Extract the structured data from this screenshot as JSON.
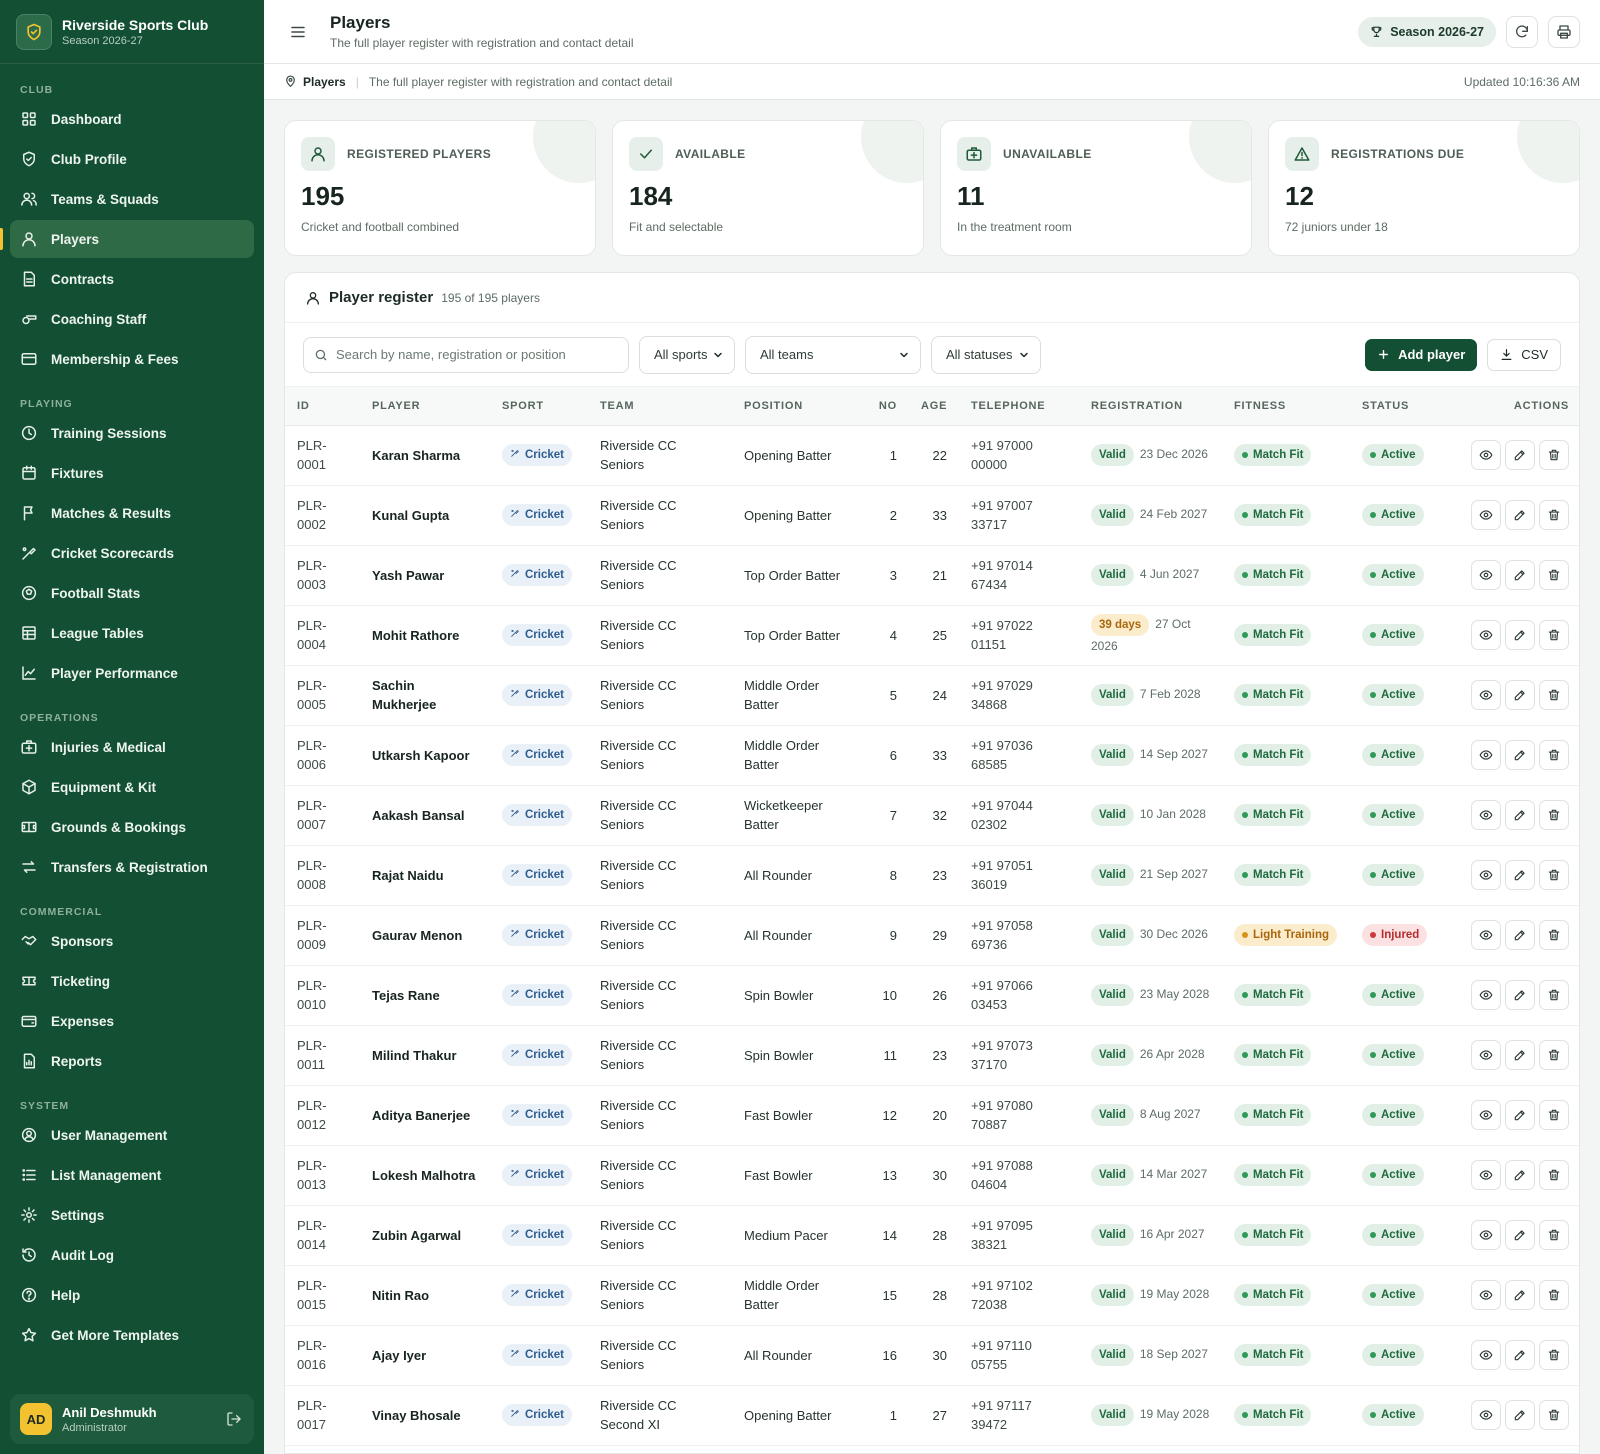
{
  "brand": {
    "name": "Riverside Sports Club",
    "season": "Season 2026-27"
  },
  "nav": [
    {
      "section": "CLUB",
      "items": [
        {
          "id": "dashboard",
          "label": "Dashboard",
          "icon": "grid-icon"
        },
        {
          "id": "club-profile",
          "label": "Club Profile",
          "icon": "shield-icon"
        },
        {
          "id": "teams",
          "label": "Teams & Squads",
          "icon": "users-icon"
        },
        {
          "id": "players",
          "label": "Players",
          "icon": "user-icon",
          "active": true
        },
        {
          "id": "contracts",
          "label": "Contracts",
          "icon": "file-icon"
        },
        {
          "id": "coaching",
          "label": "Coaching Staff",
          "icon": "whistle-icon"
        },
        {
          "id": "membership",
          "label": "Membership & Fees",
          "icon": "card-icon"
        }
      ]
    },
    {
      "section": "PLAYING",
      "items": [
        {
          "id": "training",
          "label": "Training Sessions",
          "icon": "clock-icon"
        },
        {
          "id": "fixtures",
          "label": "Fixtures",
          "icon": "calendar-icon"
        },
        {
          "id": "matches",
          "label": "Matches & Results",
          "icon": "flag-icon"
        },
        {
          "id": "scorecards",
          "label": "Cricket Scorecards",
          "icon": "bat-icon"
        },
        {
          "id": "football",
          "label": "Football Stats",
          "icon": "ball-icon"
        },
        {
          "id": "league",
          "label": "League Tables",
          "icon": "table-icon"
        },
        {
          "id": "performance",
          "label": "Player Performance",
          "icon": "chart-icon"
        }
      ]
    },
    {
      "section": "OPERATIONS",
      "items": [
        {
          "id": "injuries",
          "label": "Injuries & Medical",
          "icon": "medkit-icon"
        },
        {
          "id": "equipment",
          "label": "Equipment & Kit",
          "icon": "box-icon"
        },
        {
          "id": "grounds",
          "label": "Grounds & Bookings",
          "icon": "stadium-icon"
        },
        {
          "id": "transfers",
          "label": "Transfers & Registration",
          "icon": "transfer-icon"
        }
      ]
    },
    {
      "section": "COMMERCIAL",
      "items": [
        {
          "id": "sponsors",
          "label": "Sponsors",
          "icon": "handshake-icon"
        },
        {
          "id": "ticketing",
          "label": "Ticketing",
          "icon": "ticket-icon"
        },
        {
          "id": "expenses",
          "label": "Expenses",
          "icon": "wallet-icon"
        },
        {
          "id": "reports",
          "label": "Reports",
          "icon": "report-icon"
        }
      ]
    },
    {
      "section": "SYSTEM",
      "items": [
        {
          "id": "user-mgmt",
          "label": "User Management",
          "icon": "user-circle-icon"
        },
        {
          "id": "list-mgmt",
          "label": "List Management",
          "icon": "list-icon"
        },
        {
          "id": "settings",
          "label": "Settings",
          "icon": "gear-icon"
        },
        {
          "id": "audit",
          "label": "Audit Log",
          "icon": "history-icon"
        },
        {
          "id": "help",
          "label": "Help",
          "icon": "help-icon"
        },
        {
          "id": "templates",
          "label": "Get More Templates",
          "icon": "star-icon"
        }
      ]
    }
  ],
  "user": {
    "initials": "AD",
    "name": "Anil Deshmukh",
    "role": "Administrator"
  },
  "header": {
    "title": "Players",
    "subtitle": "The full player register with registration and contact detail",
    "season_pill": "Season 2026-27"
  },
  "breadcrumb": {
    "current": "Players",
    "description": "The full player register with registration and contact detail",
    "updated": "Updated 10:16:36 AM"
  },
  "stats": [
    {
      "icon": "user-icon",
      "label": "REGISTERED PLAYERS",
      "value": "195",
      "note": "Cricket and football combined"
    },
    {
      "icon": "check-icon",
      "label": "AVAILABLE",
      "value": "184",
      "note": "Fit and selectable"
    },
    {
      "icon": "medkit-icon",
      "label": "UNAVAILABLE",
      "value": "11",
      "note": "In the treatment room"
    },
    {
      "icon": "warning-icon",
      "label": "REGISTRATIONS DUE",
      "value": "12",
      "note": "72 juniors under 18"
    }
  ],
  "register": {
    "title": "Player register",
    "count": "195 of 195 players",
    "search_placeholder": "Search by name, registration or position",
    "filters": [
      "All sports",
      "All teams",
      "All statuses"
    ],
    "add_label": "Add player",
    "csv_label": "CSV",
    "columns": [
      "ID",
      "PLAYER",
      "SPORT",
      "TEAM",
      "POSITION",
      "NO",
      "AGE",
      "TELEPHONE",
      "REGISTRATION",
      "FITNESS",
      "STATUS",
      "ACTIONS"
    ],
    "rows": [
      {
        "id": "PLR-0001",
        "player": "Karan Sharma",
        "sport": "Cricket",
        "team": "Riverside CC Seniors",
        "position": "Opening Batter",
        "no": "1",
        "age": "22",
        "tel": "+91 97000 00000",
        "reg_status": "Valid",
        "reg_date": "23 Dec 2026",
        "fitness": "Match Fit",
        "status": "Active"
      },
      {
        "id": "PLR-0002",
        "player": "Kunal Gupta",
        "sport": "Cricket",
        "team": "Riverside CC Seniors",
        "position": "Opening Batter",
        "no": "2",
        "age": "33",
        "tel": "+91 97007 33717",
        "reg_status": "Valid",
        "reg_date": "24 Feb 2027",
        "fitness": "Match Fit",
        "status": "Active"
      },
      {
        "id": "PLR-0003",
        "player": "Yash Pawar",
        "sport": "Cricket",
        "team": "Riverside CC Seniors",
        "position": "Top Order Batter",
        "no": "3",
        "age": "21",
        "tel": "+91 97014 67434",
        "reg_status": "Valid",
        "reg_date": "4 Jun 2027",
        "fitness": "Match Fit",
        "status": "Active"
      },
      {
        "id": "PLR-0004",
        "player": "Mohit Rathore",
        "sport": "Cricket",
        "team": "Riverside CC Seniors",
        "position": "Top Order Batter",
        "no": "4",
        "age": "25",
        "tel": "+91 97022 01151",
        "reg_status": "39 days",
        "reg_date": "27 Oct 2026",
        "fitness": "Match Fit",
        "status": "Active"
      },
      {
        "id": "PLR-0005",
        "player": "Sachin Mukherjee",
        "sport": "Cricket",
        "team": "Riverside CC Seniors",
        "position": "Middle Order Batter",
        "no": "5",
        "age": "24",
        "tel": "+91 97029 34868",
        "reg_status": "Valid",
        "reg_date": "7 Feb 2028",
        "fitness": "Match Fit",
        "status": "Active"
      },
      {
        "id": "PLR-0006",
        "player": "Utkarsh Kapoor",
        "sport": "Cricket",
        "team": "Riverside CC Seniors",
        "position": "Middle Order Batter",
        "no": "6",
        "age": "33",
        "tel": "+91 97036 68585",
        "reg_status": "Valid",
        "reg_date": "14 Sep 2027",
        "fitness": "Match Fit",
        "status": "Active"
      },
      {
        "id": "PLR-0007",
        "player": "Aakash Bansal",
        "sport": "Cricket",
        "team": "Riverside CC Seniors",
        "position": "Wicketkeeper Batter",
        "no": "7",
        "age": "32",
        "tel": "+91 97044 02302",
        "reg_status": "Valid",
        "reg_date": "10 Jan 2028",
        "fitness": "Match Fit",
        "status": "Active"
      },
      {
        "id": "PLR-0008",
        "player": "Rajat Naidu",
        "sport": "Cricket",
        "team": "Riverside CC Seniors",
        "position": "All Rounder",
        "no": "8",
        "age": "23",
        "tel": "+91 97051 36019",
        "reg_status": "Valid",
        "reg_date": "21 Sep 2027",
        "fitness": "Match Fit",
        "status": "Active"
      },
      {
        "id": "PLR-0009",
        "player": "Gaurav Menon",
        "sport": "Cricket",
        "team": "Riverside CC Seniors",
        "position": "All Rounder",
        "no": "9",
        "age": "29",
        "tel": "+91 97058 69736",
        "reg_status": "Valid",
        "reg_date": "30 Dec 2026",
        "fitness": "Light Training",
        "status": "Injured"
      },
      {
        "id": "PLR-0010",
        "player": "Tejas Rane",
        "sport": "Cricket",
        "team": "Riverside CC Seniors",
        "position": "Spin Bowler",
        "no": "10",
        "age": "26",
        "tel": "+91 97066 03453",
        "reg_status": "Valid",
        "reg_date": "23 May 2028",
        "fitness": "Match Fit",
        "status": "Active"
      },
      {
        "id": "PLR-0011",
        "player": "Milind Thakur",
        "sport": "Cricket",
        "team": "Riverside CC Seniors",
        "position": "Spin Bowler",
        "no": "11",
        "age": "23",
        "tel": "+91 97073 37170",
        "reg_status": "Valid",
        "reg_date": "26 Apr 2028",
        "fitness": "Match Fit",
        "status": "Active"
      },
      {
        "id": "PLR-0012",
        "player": "Aditya Banerjee",
        "sport": "Cricket",
        "team": "Riverside CC Seniors",
        "position": "Fast Bowler",
        "no": "12",
        "age": "20",
        "tel": "+91 97080 70887",
        "reg_status": "Valid",
        "reg_date": "8 Aug 2027",
        "fitness": "Match Fit",
        "status": "Active"
      },
      {
        "id": "PLR-0013",
        "player": "Lokesh Malhotra",
        "sport": "Cricket",
        "team": "Riverside CC Seniors",
        "position": "Fast Bowler",
        "no": "13",
        "age": "30",
        "tel": "+91 97088 04604",
        "reg_status": "Valid",
        "reg_date": "14 Mar 2027",
        "fitness": "Match Fit",
        "status": "Active"
      },
      {
        "id": "PLR-0014",
        "player": "Zubin Agarwal",
        "sport": "Cricket",
        "team": "Riverside CC Seniors",
        "position": "Medium Pacer",
        "no": "14",
        "age": "28",
        "tel": "+91 97095 38321",
        "reg_status": "Valid",
        "reg_date": "16 Apr 2027",
        "fitness": "Match Fit",
        "status": "Active"
      },
      {
        "id": "PLR-0015",
        "player": "Nitin Rao",
        "sport": "Cricket",
        "team": "Riverside CC Seniors",
        "position": "Middle Order Batter",
        "no": "15",
        "age": "28",
        "tel": "+91 97102 72038",
        "reg_status": "Valid",
        "reg_date": "19 May 2028",
        "fitness": "Match Fit",
        "status": "Active"
      },
      {
        "id": "PLR-0016",
        "player": "Ajay Iyer",
        "sport": "Cricket",
        "team": "Riverside CC Seniors",
        "position": "All Rounder",
        "no": "16",
        "age": "30",
        "tel": "+91 97110 05755",
        "reg_status": "Valid",
        "reg_date": "18 Sep 2027",
        "fitness": "Match Fit",
        "status": "Active"
      },
      {
        "id": "PLR-0017",
        "player": "Vinay Bhosale",
        "sport": "Cricket",
        "team": "Riverside CC Second XI",
        "position": "Opening Batter",
        "no": "1",
        "age": "27",
        "tel": "+91 97117 39472",
        "reg_status": "Valid",
        "reg_date": "19 May 2028",
        "fitness": "Match Fit",
        "status": "Active"
      }
    ]
  },
  "colors": {
    "sidebar": "#134f32",
    "accent": "#f2c230",
    "valid": "#1f6a3f",
    "warning": "#a9670d",
    "danger": "#b42d2d"
  }
}
